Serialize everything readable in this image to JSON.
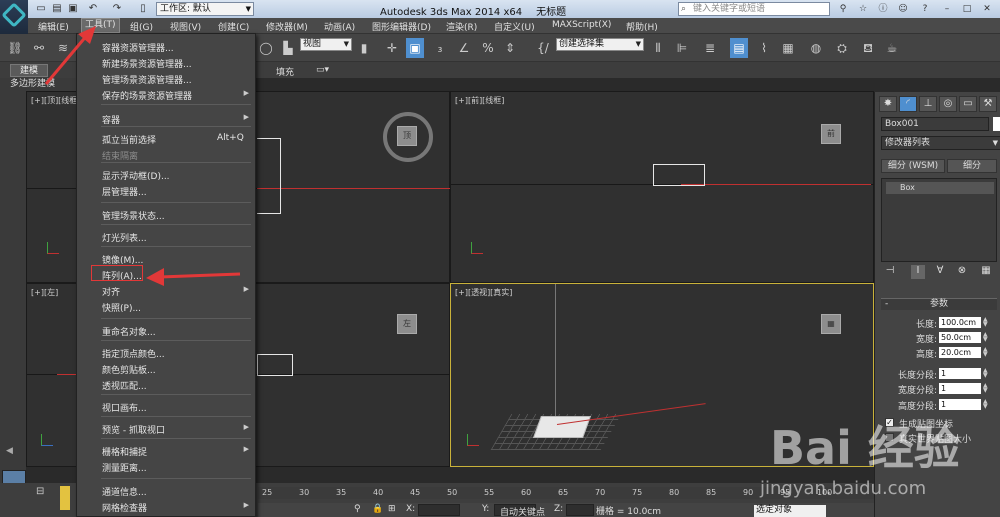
{
  "title": {
    "app": "Autodesk 3ds Max  2014 x64",
    "doc": "无标题"
  },
  "workspace": {
    "label": "工作区: 默认"
  },
  "search": {
    "placeholder": "键入关键字或短语"
  },
  "menubar": [
    "编辑(E)",
    "工具(T)",
    "组(G)",
    "视图(V)",
    "创建(C)",
    "修改器(M)",
    "动画(A)",
    "图形编辑器(D)",
    "渲染(R)",
    "自定义(U)",
    "MAXScript(X)",
    "帮助(H)"
  ],
  "toolbar": {
    "view": "视图",
    "selection_set": "创建选择集"
  },
  "ribbon": {
    "tab_model": "建模",
    "fill": "填充",
    "poly": "多边形建模"
  },
  "viewports": {
    "top": "[+][顶][线框]",
    "front": "[+][前][线框]",
    "left": "[+][左]",
    "persp": "[+][透视][真实]"
  },
  "tools_menu": [
    {
      "label": "容器资源管理器...",
      "shortcut": "",
      "submenu": false,
      "disabled": false
    },
    {
      "label": "新建场景资源管理器...",
      "shortcut": "",
      "submenu": false,
      "disabled": false
    },
    {
      "label": "管理场景资源管理器...",
      "shortcut": "",
      "submenu": false,
      "disabled": false
    },
    {
      "label": "保存的场景资源管理器",
      "shortcut": "",
      "submenu": true,
      "disabled": false
    },
    {
      "label": "容器",
      "shortcut": "",
      "submenu": true,
      "disabled": false
    },
    {
      "label": "孤立当前选择",
      "shortcut": "Alt+Q",
      "submenu": false,
      "disabled": false
    },
    {
      "label": "结束隔离",
      "shortcut": "",
      "submenu": false,
      "disabled": true
    },
    {
      "label": "显示浮动框(D)...",
      "shortcut": "",
      "submenu": false,
      "disabled": false
    },
    {
      "label": "层管理器...",
      "shortcut": "",
      "submenu": false,
      "disabled": false
    },
    {
      "label": "管理场景状态...",
      "shortcut": "",
      "submenu": false,
      "disabled": false
    },
    {
      "label": "灯光列表...",
      "shortcut": "",
      "submenu": false,
      "disabled": false
    },
    {
      "label": "镜像(M)...",
      "shortcut": "",
      "submenu": false,
      "disabled": false
    },
    {
      "label": "阵列(A)...",
      "shortcut": "",
      "submenu": false,
      "disabled": false
    },
    {
      "label": "对齐",
      "shortcut": "",
      "submenu": true,
      "disabled": false
    },
    {
      "label": "快照(P)...",
      "shortcut": "",
      "submenu": false,
      "disabled": false
    },
    {
      "label": "重命名对象...",
      "shortcut": "",
      "submenu": false,
      "disabled": false
    },
    {
      "label": "指定顶点颜色...",
      "shortcut": "",
      "submenu": false,
      "disabled": false
    },
    {
      "label": "颜色剪贴板...",
      "shortcut": "",
      "submenu": false,
      "disabled": false
    },
    {
      "label": "透视匹配...",
      "shortcut": "",
      "submenu": false,
      "disabled": false
    },
    {
      "label": "视口画布...",
      "shortcut": "",
      "submenu": false,
      "disabled": false
    },
    {
      "label": "预览 - 抓取视口",
      "shortcut": "",
      "submenu": true,
      "disabled": false
    },
    {
      "label": "栅格和捕捉",
      "shortcut": "",
      "submenu": true,
      "disabled": false
    },
    {
      "label": "测量距离...",
      "shortcut": "",
      "submenu": false,
      "disabled": false
    },
    {
      "label": "通道信息...",
      "shortcut": "",
      "submenu": false,
      "disabled": false
    },
    {
      "label": "网格检查器",
      "shortcut": "",
      "submenu": true,
      "disabled": false
    }
  ],
  "panel": {
    "object_name": "Box001",
    "modifier_list": "修改器列表",
    "btn_subdiv_wsm": "细分 (WSM)",
    "btn_subdiv": "细分",
    "stack_item": "Box",
    "params_title": "参数",
    "params": [
      {
        "label": "长度:",
        "value": "100.0cm"
      },
      {
        "label": "宽度:",
        "value": "50.0cm"
      },
      {
        "label": "高度:",
        "value": "20.0cm"
      },
      {
        "label": "长度分段:",
        "value": "1"
      },
      {
        "label": "宽度分段:",
        "value": "1"
      },
      {
        "label": "高度分段:",
        "value": "1"
      }
    ],
    "gen_map": "生成贴图坐标",
    "real_world": "真实世界贴图大小"
  },
  "timeline": {
    "ticks": [
      "25",
      "30",
      "35",
      "40",
      "45",
      "50",
      "55",
      "60",
      "65",
      "70",
      "75",
      "80",
      "85",
      "90",
      "95",
      "100"
    ]
  },
  "status": {
    "x": "X:",
    "y": "Y:",
    "z": "Z:",
    "grid": "栅格 = 10.0cm",
    "autokey": "自动关键点",
    "selobj": "选定对象"
  },
  "watermark": {
    "logo": "Bai 经验",
    "url": "jingyan.baidu.com"
  }
}
